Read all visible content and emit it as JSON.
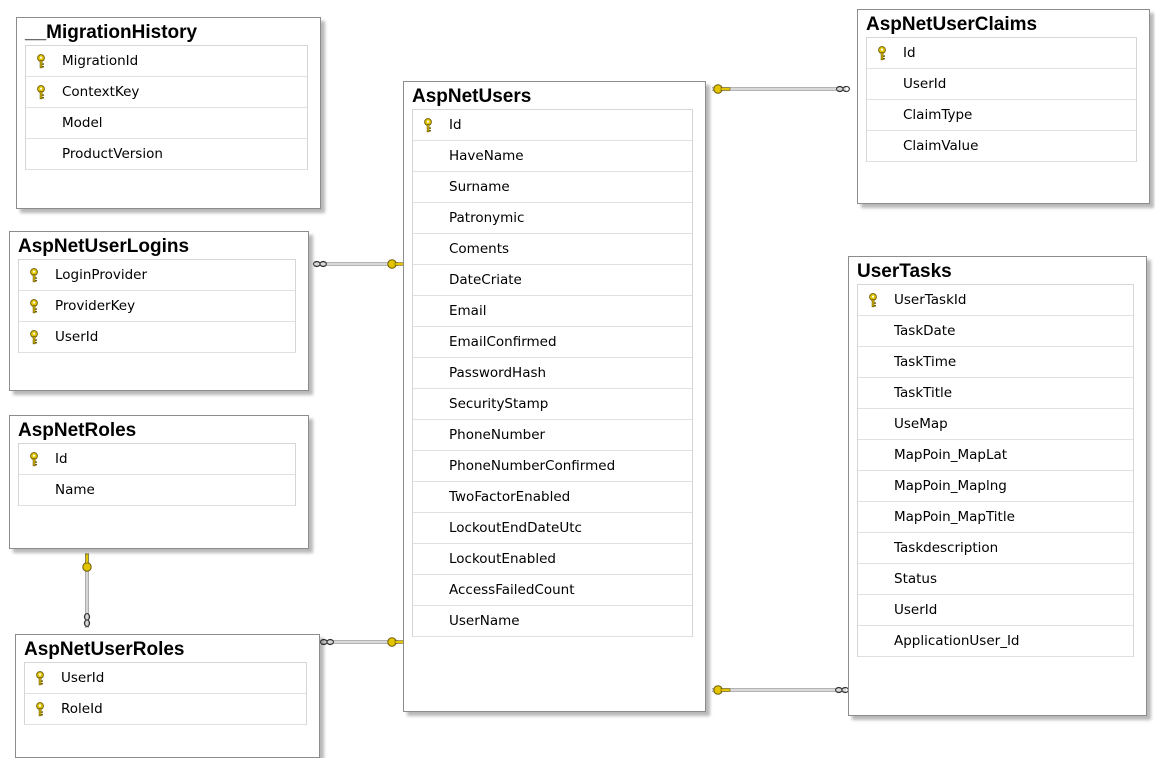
{
  "colors": {
    "background": "#ffffff",
    "table_border": "#8c8c8c",
    "key": "#e2c400",
    "connector": "#9a9a9a"
  },
  "tables": {
    "migration_history": {
      "title": "__MigrationHistory",
      "columns": [
        {
          "name": "MigrationId",
          "primary_key": true
        },
        {
          "name": "ContextKey",
          "primary_key": true
        },
        {
          "name": "Model",
          "primary_key": false
        },
        {
          "name": "ProductVersion",
          "primary_key": false
        }
      ]
    },
    "asp_net_user_logins": {
      "title": "AspNetUserLogins",
      "columns": [
        {
          "name": "LoginProvider",
          "primary_key": true
        },
        {
          "name": "ProviderKey",
          "primary_key": true
        },
        {
          "name": "UserId",
          "primary_key": true
        }
      ]
    },
    "asp_net_roles": {
      "title": "AspNetRoles",
      "columns": [
        {
          "name": "Id",
          "primary_key": true
        },
        {
          "name": "Name",
          "primary_key": false
        }
      ]
    },
    "asp_net_user_roles": {
      "title": "AspNetUserRoles",
      "columns": [
        {
          "name": "UserId",
          "primary_key": true
        },
        {
          "name": "RoleId",
          "primary_key": true
        }
      ]
    },
    "asp_net_users": {
      "title": "AspNetUsers",
      "columns": [
        {
          "name": "Id",
          "primary_key": true
        },
        {
          "name": "HaveName",
          "primary_key": false
        },
        {
          "name": "Surname",
          "primary_key": false
        },
        {
          "name": "Patronymic",
          "primary_key": false
        },
        {
          "name": "Coments",
          "primary_key": false
        },
        {
          "name": "DateCriate",
          "primary_key": false
        },
        {
          "name": "Email",
          "primary_key": false
        },
        {
          "name": "EmailConfirmed",
          "primary_key": false
        },
        {
          "name": "PasswordHash",
          "primary_key": false
        },
        {
          "name": "SecurityStamp",
          "primary_key": false
        },
        {
          "name": "PhoneNumber",
          "primary_key": false
        },
        {
          "name": "PhoneNumberConfirmed",
          "primary_key": false
        },
        {
          "name": "TwoFactorEnabled",
          "primary_key": false
        },
        {
          "name": "LockoutEndDateUtc",
          "primary_key": false
        },
        {
          "name": "LockoutEnabled",
          "primary_key": false
        },
        {
          "name": "AccessFailedCount",
          "primary_key": false
        },
        {
          "name": "UserName",
          "primary_key": false
        }
      ]
    },
    "asp_net_user_claims": {
      "title": "AspNetUserClaims",
      "columns": [
        {
          "name": "Id",
          "primary_key": true
        },
        {
          "name": "UserId",
          "primary_key": false
        },
        {
          "name": "ClaimType",
          "primary_key": false
        },
        {
          "name": "ClaimValue",
          "primary_key": false
        }
      ]
    },
    "user_tasks": {
      "title": "UserTasks",
      "columns": [
        {
          "name": "UserTaskId",
          "primary_key": true
        },
        {
          "name": "TaskDate",
          "primary_key": false
        },
        {
          "name": "TaskTime",
          "primary_key": false
        },
        {
          "name": "TaskTitle",
          "primary_key": false
        },
        {
          "name": "UseMap",
          "primary_key": false
        },
        {
          "name": "MapPoin_MapLat",
          "primary_key": false
        },
        {
          "name": "MapPoin_Maplng",
          "primary_key": false
        },
        {
          "name": "MapPoin_MapTitle",
          "primary_key": false
        },
        {
          "name": "Taskdescription",
          "primary_key": false
        },
        {
          "name": "Status",
          "primary_key": false
        },
        {
          "name": "UserId",
          "primary_key": false
        },
        {
          "name": "ApplicationUser_Id",
          "primary_key": false
        }
      ]
    }
  },
  "relationships": [
    {
      "one": "asp_net_users",
      "many": "asp_net_user_logins"
    },
    {
      "one": "asp_net_users",
      "many": "asp_net_user_roles"
    },
    {
      "one": "asp_net_users",
      "many": "asp_net_user_claims"
    },
    {
      "one": "asp_net_users",
      "many": "user_tasks"
    },
    {
      "one": "asp_net_roles",
      "many": "asp_net_user_roles"
    }
  ]
}
